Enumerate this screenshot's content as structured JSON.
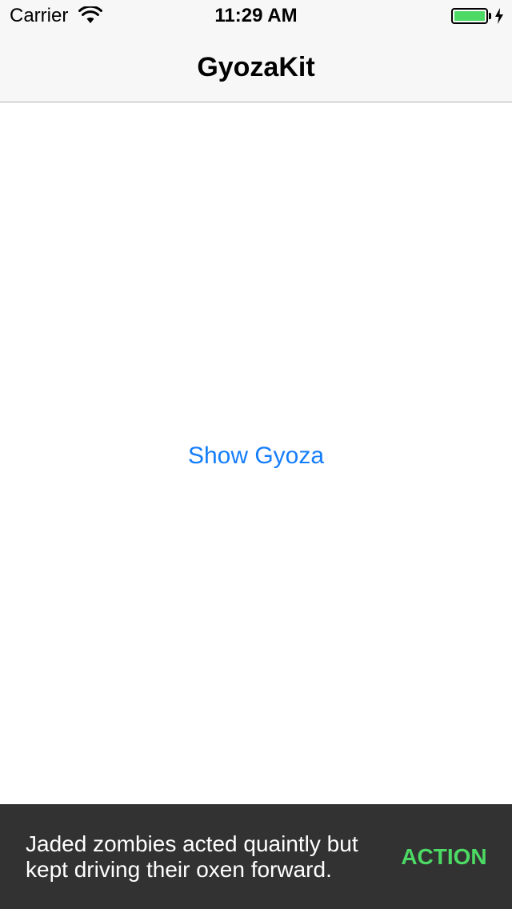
{
  "status_bar": {
    "carrier": "Carrier",
    "time": "11:29 AM",
    "wifi_icon": "wifi-icon",
    "battery_icon": "battery-icon",
    "charging_icon": "charging-bolt-icon",
    "battery_level": 1.0
  },
  "nav": {
    "title": "GyozaKit"
  },
  "main": {
    "show_button_label": "Show Gyoza"
  },
  "snackbar": {
    "message": "Jaded zombies acted quaintly but kept driving their oxen forward.",
    "action_label": "ACTION"
  },
  "colors": {
    "tint": "#157efb",
    "snackbar_background": "#323232",
    "action_text": "#4cd964",
    "battery_fill": "#4cd964"
  }
}
